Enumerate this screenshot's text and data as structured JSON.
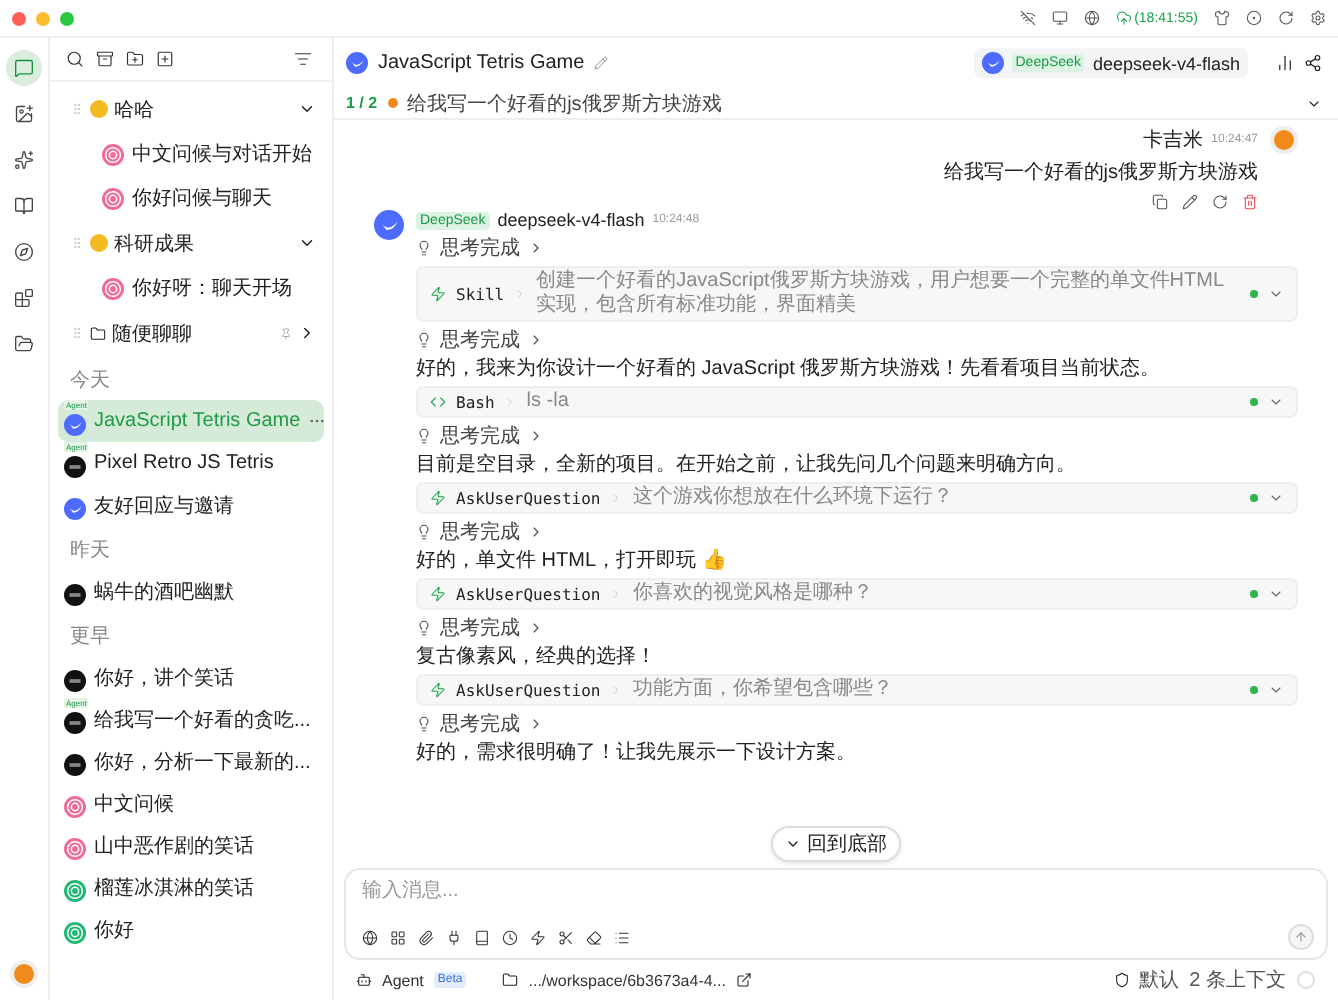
{
  "top_bar": {
    "sync_time": "(18:41:55)"
  },
  "rail": {
    "items": [
      {
        "kind": "chat",
        "selected": true
      },
      {
        "kind": "image",
        "selected": false
      },
      {
        "kind": "sparkle",
        "selected": false
      },
      {
        "kind": "book",
        "selected": false
      },
      {
        "kind": "compass",
        "selected": false
      },
      {
        "kind": "apps",
        "selected": false
      },
      {
        "kind": "files",
        "selected": false
      }
    ]
  },
  "sidebar": {
    "groups": [
      {
        "label": "哈哈",
        "kind": "emoji",
        "expanded": true,
        "children": [
          {
            "title": "中文问候与对话开始",
            "kind": "pink"
          },
          {
            "title": "你好问候与聊天",
            "kind": "pink"
          }
        ]
      },
      {
        "label": "科研成果",
        "kind": "emoji",
        "expanded": true,
        "children": [
          {
            "title": "你好呀：聊天开场",
            "kind": "pink"
          }
        ]
      },
      {
        "label": "随便聊聊",
        "kind": "folder",
        "expanded": false
      }
    ],
    "sections": [
      {
        "label": "今天",
        "items": [
          {
            "title": "JavaScript Tetris Game",
            "kind": "deepseek",
            "badge": "Agent",
            "selected": true
          },
          {
            "title": "Pixel Retro JS Tetris",
            "kind": "dark",
            "badge": "Agent",
            "selected": false
          },
          {
            "title": "友好回应与邀请",
            "kind": "deepseek",
            "selected": false
          }
        ]
      },
      {
        "label": "昨天",
        "items": [
          {
            "title": "蜗牛的酒吧幽默",
            "kind": "dark",
            "selected": false
          }
        ]
      },
      {
        "label": "更早",
        "items": [
          {
            "title": "你好，讲个笑话",
            "kind": "dark",
            "selected": false
          },
          {
            "title": "给我写一个好看的贪吃...",
            "kind": "dark",
            "badge": "Agent",
            "selected": false
          },
          {
            "title": "你好，分析一下最新的...",
            "kind": "dark",
            "selected": false
          },
          {
            "title": "中文问候",
            "kind": "pink",
            "selected": false
          },
          {
            "title": "山中恶作剧的笑话",
            "kind": "pink",
            "selected": false
          },
          {
            "title": "榴莲冰淇淋的笑话",
            "kind": "green",
            "selected": false
          },
          {
            "title": "你好",
            "kind": "green",
            "selected": false
          }
        ]
      }
    ]
  },
  "chat_header": {
    "title": "JavaScript Tetris Game",
    "provider": "DeepSeek",
    "model": "deepseek-v4-flash"
  },
  "thread": {
    "position": "1 / 2",
    "prompt": "给我写一个好看的js俄罗斯方块游戏"
  },
  "user_message": {
    "author": "卡吉米",
    "time": "10:24:47",
    "text": "给我写一个好看的js俄罗斯方块游戏"
  },
  "assistant_message": {
    "provider": "DeepSeek",
    "model": "deepseek-v4-flash",
    "time": "10:24:48",
    "blocks": [
      {
        "kind": "thinking",
        "label": "思考完成"
      },
      {
        "kind": "tool",
        "name": "Skill",
        "detail": "创建一个好看的JavaScript俄罗斯方块游戏，用户想要一个完整的单文件HTML实现，包含所有标准功能，界面精美"
      },
      {
        "kind": "thinking",
        "label": "思考完成"
      },
      {
        "kind": "text",
        "text": "好的，我来为你设计一个好看的 JavaScript 俄罗斯方块游戏！先看看项目当前状态。"
      },
      {
        "kind": "shell",
        "name": "Bash",
        "detail": "ls -la"
      },
      {
        "kind": "thinking",
        "label": "思考完成"
      },
      {
        "kind": "text",
        "text": "目前是空目录，全新的项目。在开始之前，让我先问几个问题来明确方向。"
      },
      {
        "kind": "tool",
        "name": "AskUserQuestion",
        "detail": "这个游戏你想放在什么环境下运行？"
      },
      {
        "kind": "thinking",
        "label": "思考完成"
      },
      {
        "kind": "text",
        "text": "好的，单文件 HTML，打开即玩 👍"
      },
      {
        "kind": "tool",
        "name": "AskUserQuestion",
        "detail": "你喜欢的视觉风格是哪种？"
      },
      {
        "kind": "thinking",
        "label": "思考完成"
      },
      {
        "kind": "text",
        "text": "复古像素风，经典的选择！"
      },
      {
        "kind": "tool",
        "name": "AskUserQuestion",
        "detail": "功能方面，你希望包含哪些？"
      },
      {
        "kind": "thinking",
        "label": "思考完成"
      },
      {
        "kind": "text",
        "text": "好的，需求很明确了！让我先展示一下设计方案。"
      }
    ]
  },
  "scroll_button": {
    "label": "回到底部"
  },
  "composer": {
    "placeholder": "输入消息..."
  },
  "footer": {
    "mode": "Agent",
    "beta": "Beta",
    "path": ".../workspace/6b3673a4-4...",
    "permission": "默认",
    "context": "2 条上下文"
  }
}
